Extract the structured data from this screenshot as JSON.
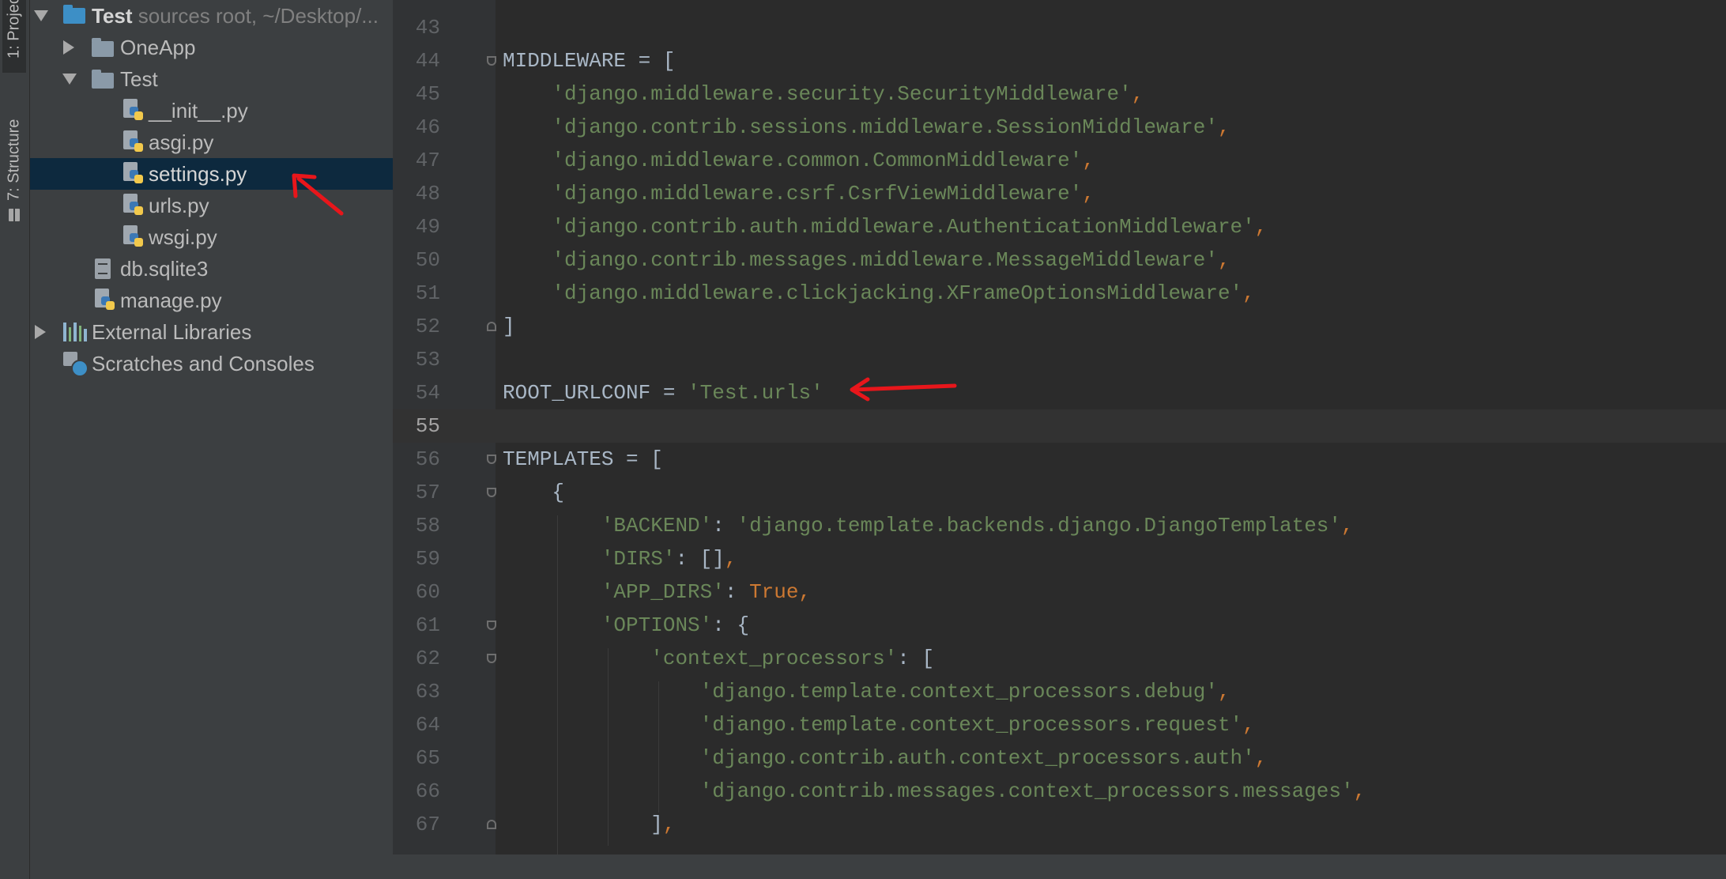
{
  "toolwindows": [
    {
      "label": "1: Project",
      "icon": "folder-icon"
    },
    {
      "label": "7: Structure",
      "icon": "structure-icon"
    }
  ],
  "project_tree": {
    "root": {
      "name": "Test",
      "detail": "sources root,  ~/Desktop/..."
    },
    "items": [
      {
        "label": "OneApp",
        "icon": "folder-icon"
      },
      {
        "label": "Test",
        "icon": "folder-icon"
      },
      {
        "label": "__init__.py",
        "icon": "python-file-icon"
      },
      {
        "label": "asgi.py",
        "icon": "python-file-icon"
      },
      {
        "label": "settings.py",
        "icon": "python-file-icon"
      },
      {
        "label": "urls.py",
        "icon": "python-file-icon"
      },
      {
        "label": "wsgi.py",
        "icon": "python-file-icon"
      },
      {
        "label": "db.sqlite3",
        "icon": "database-file-icon"
      },
      {
        "label": "manage.py",
        "icon": "python-file-icon"
      },
      {
        "label": "External Libraries",
        "icon": "library-icon"
      },
      {
        "label": "Scratches and Consoles",
        "icon": "scratch-icon"
      }
    ],
    "selected": "settings.py"
  },
  "editor": {
    "current_line": "55",
    "lines": [
      {
        "num": "43",
        "tokens": []
      },
      {
        "num": "44",
        "tokens": [
          [
            "plain",
            "MIDDLEWARE = ["
          ]
        ]
      },
      {
        "num": "45",
        "tokens": [
          [
            "plain",
            "    "
          ],
          [
            "str",
            "'django.middleware.security.SecurityMiddleware'"
          ],
          [
            "punc",
            ","
          ]
        ]
      },
      {
        "num": "46",
        "tokens": [
          [
            "plain",
            "    "
          ],
          [
            "str",
            "'django.contrib.sessions.middleware.SessionMiddleware'"
          ],
          [
            "punc",
            ","
          ]
        ]
      },
      {
        "num": "47",
        "tokens": [
          [
            "plain",
            "    "
          ],
          [
            "str",
            "'django.middleware.common.CommonMiddleware'"
          ],
          [
            "punc",
            ","
          ]
        ]
      },
      {
        "num": "48",
        "tokens": [
          [
            "plain",
            "    "
          ],
          [
            "str",
            "'django.middleware.csrf.CsrfViewMiddleware'"
          ],
          [
            "punc",
            ","
          ]
        ]
      },
      {
        "num": "49",
        "tokens": [
          [
            "plain",
            "    "
          ],
          [
            "str",
            "'django.contrib.auth.middleware.AuthenticationMiddleware'"
          ],
          [
            "punc",
            ","
          ]
        ]
      },
      {
        "num": "50",
        "tokens": [
          [
            "plain",
            "    "
          ],
          [
            "str",
            "'django.contrib.messages.middleware.MessageMiddleware'"
          ],
          [
            "punc",
            ","
          ]
        ]
      },
      {
        "num": "51",
        "tokens": [
          [
            "plain",
            "    "
          ],
          [
            "str",
            "'django.middleware.clickjacking.XFrameOptionsMiddleware'"
          ],
          [
            "punc",
            ","
          ]
        ]
      },
      {
        "num": "52",
        "tokens": [
          [
            "plain",
            "]"
          ]
        ]
      },
      {
        "num": "53",
        "tokens": []
      },
      {
        "num": "54",
        "tokens": [
          [
            "plain",
            "ROOT_URLCONF = "
          ],
          [
            "str",
            "'Test.urls'"
          ]
        ]
      },
      {
        "num": "55",
        "tokens": []
      },
      {
        "num": "56",
        "tokens": [
          [
            "plain",
            "TEMPLATES = ["
          ]
        ]
      },
      {
        "num": "57",
        "tokens": [
          [
            "plain",
            "    {"
          ]
        ]
      },
      {
        "num": "58",
        "tokens": [
          [
            "plain",
            "        "
          ],
          [
            "str",
            "'BACKEND'"
          ],
          [
            "plain",
            ": "
          ],
          [
            "str",
            "'django.template.backends.django.DjangoTemplates'"
          ],
          [
            "punc",
            ","
          ]
        ]
      },
      {
        "num": "59",
        "tokens": [
          [
            "plain",
            "        "
          ],
          [
            "str",
            "'DIRS'"
          ],
          [
            "plain",
            ": []"
          ],
          [
            "punc",
            ","
          ]
        ]
      },
      {
        "num": "60",
        "tokens": [
          [
            "plain",
            "        "
          ],
          [
            "str",
            "'APP_DIRS'"
          ],
          [
            "plain",
            ": "
          ],
          [
            "kw",
            "True"
          ],
          [
            "punc",
            ","
          ]
        ]
      },
      {
        "num": "61",
        "tokens": [
          [
            "plain",
            "        "
          ],
          [
            "str",
            "'OPTIONS'"
          ],
          [
            "plain",
            ": {"
          ]
        ]
      },
      {
        "num": "62",
        "tokens": [
          [
            "plain",
            "            "
          ],
          [
            "str",
            "'context_processors'"
          ],
          [
            "plain",
            ": ["
          ]
        ]
      },
      {
        "num": "63",
        "tokens": [
          [
            "plain",
            "                "
          ],
          [
            "str",
            "'django.template.context_processors.debug'"
          ],
          [
            "punc",
            ","
          ]
        ]
      },
      {
        "num": "64",
        "tokens": [
          [
            "plain",
            "                "
          ],
          [
            "str",
            "'django.template.context_processors.request'"
          ],
          [
            "punc",
            ","
          ]
        ]
      },
      {
        "num": "65",
        "tokens": [
          [
            "plain",
            "                "
          ],
          [
            "str",
            "'django.contrib.auth.context_processors.auth'"
          ],
          [
            "punc",
            ","
          ]
        ]
      },
      {
        "num": "66",
        "tokens": [
          [
            "plain",
            "                "
          ],
          [
            "str",
            "'django.contrib.messages.context_processors.messages'"
          ],
          [
            "punc",
            ","
          ]
        ]
      },
      {
        "num": "67",
        "tokens": [
          [
            "plain",
            "            ]"
          ],
          [
            "punc",
            ","
          ]
        ]
      }
    ]
  }
}
